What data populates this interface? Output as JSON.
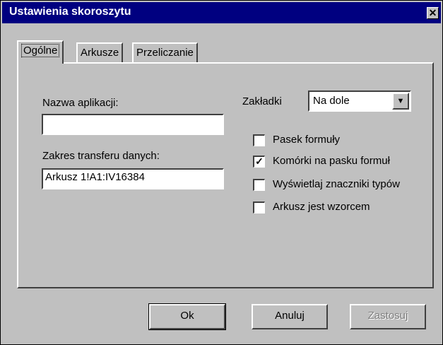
{
  "window": {
    "title": "Ustawienia skoroszytu",
    "close_symbol": "✕"
  },
  "tabs": [
    {
      "label": "Ogólne",
      "active": true
    },
    {
      "label": "Arkusze",
      "active": false
    },
    {
      "label": "Przeliczanie",
      "active": false
    }
  ],
  "general": {
    "app_name_label": "Nazwa aplikacji:",
    "app_name_value": "",
    "transfer_range_label": "Zakres transferu danych:",
    "transfer_range_value": "Arkusz 1!A1:IV16384",
    "tabs_label": "Zakładki",
    "tabs_position_value": "Na dole"
  },
  "checkboxes": [
    {
      "label": "Pasek formuły",
      "checked": false
    },
    {
      "label": "Komórki na pasku formuł",
      "checked": true
    },
    {
      "label": "Wyświetlaj znaczniki typów",
      "checked": false
    },
    {
      "label": "Arkusz jest wzorcem",
      "checked": false
    }
  ],
  "buttons": {
    "ok": "Ok",
    "cancel": "Anuluj",
    "apply": "Zastosuj"
  },
  "icons": {
    "close": "close-icon",
    "dropdown": "chevron-down-icon",
    "check": "checkmark-icon"
  }
}
